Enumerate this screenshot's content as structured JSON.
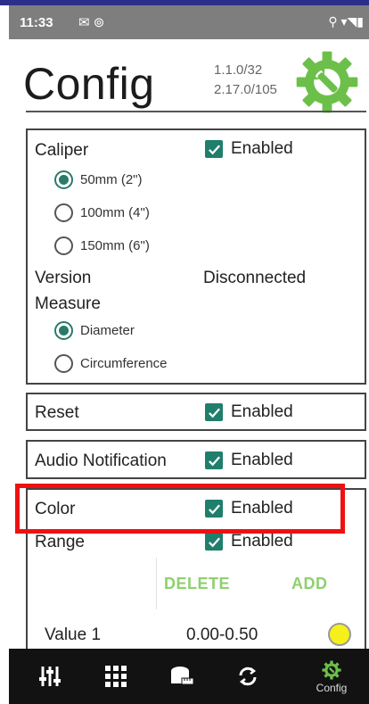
{
  "status_bar": {
    "time": "11:33",
    "left_icons": "✉ ⊚",
    "right_icons": "⚲ ▾◥▮"
  },
  "header": {
    "title": "Config",
    "version_line1": "1.1.0/32",
    "version_line2": "2.17.0/105",
    "icon": "gear-wrench-icon",
    "accent_color": "#6cc04a"
  },
  "caliper": {
    "label": "Caliper",
    "enabled_label": "Enabled",
    "enabled": true,
    "size_options": [
      {
        "label": "50mm (2\")",
        "selected": true
      },
      {
        "label": "100mm (4\")",
        "selected": false
      },
      {
        "label": "150mm (6\")",
        "selected": false
      }
    ],
    "version_label": "Version",
    "version_value": "Disconnected",
    "measure_label": "Measure",
    "measure_options": [
      {
        "label": "Diameter",
        "selected": true
      },
      {
        "label": "Circumference",
        "selected": false
      }
    ]
  },
  "reset": {
    "label": "Reset",
    "enabled_label": "Enabled",
    "enabled": true
  },
  "audio": {
    "label": "Audio Notification",
    "enabled_label": "Enabled",
    "enabled": true
  },
  "color": {
    "label": "Color",
    "enabled_label": "Enabled",
    "enabled": true,
    "range_label": "Range",
    "range_enabled_label": "Enabled",
    "delete_label": "DELETE",
    "add_label": "ADD",
    "value_label": "Value 1",
    "value_range": "0.00-0.50",
    "value_color": "#f5f01a"
  },
  "bottom_nav": {
    "items": [
      {
        "icon": "sliders-icon",
        "label": ""
      },
      {
        "icon": "grid-icon",
        "label": ""
      },
      {
        "icon": "tape-measure-icon",
        "label": ""
      },
      {
        "icon": "sync-icon",
        "label": ""
      },
      {
        "icon": "gear-wrench-icon",
        "label": "Config"
      }
    ],
    "active_color": "#6cc04a"
  },
  "checkbox_color": "#1f7e6c",
  "highlight_color": "#ee1111"
}
